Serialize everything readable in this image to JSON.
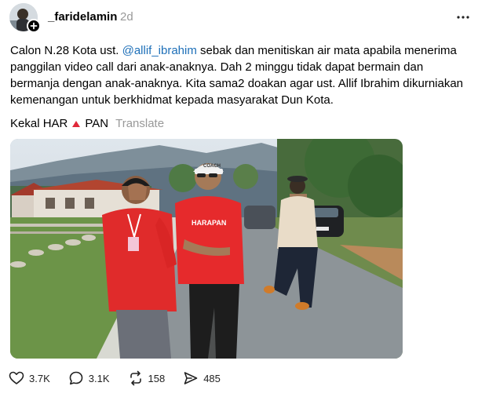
{
  "post": {
    "username": "_faridelamin",
    "timestamp": "2d",
    "caption": {
      "prefix": "Calon N.28 Kota ust. ",
      "mention": "@allif_ibrahim",
      "suffix": " sebak dan menitiskan air mata apabila menerima panggilan video call dari anak-anaknya. Dah 2 minggu tidak dapat bermain dan bermanja dengan anak-anaknya. Kita sama2 doakan agar ust. Allif Ibrahim dikurniakan kemenangan untuk berkhidmat kepada masyarakat Dun Kota."
    },
    "tags": {
      "left": "Kekal HAR",
      "right": "PAN",
      "translate_label": "Translate"
    },
    "photo": {
      "shirt_text": "HARAPAN",
      "cap_text": "COACH"
    },
    "actions": {
      "likes": "3.7K",
      "replies": "3.1K",
      "reposts": "158",
      "shares": "485"
    }
  },
  "icons": {
    "follow": "plus-icon",
    "more": "more-horizontal-icon",
    "like": "heart-icon",
    "reply": "comment-icon",
    "repost": "repost-icon",
    "share": "send-icon"
  },
  "colors": {
    "mention": "#1d6fb8",
    "timestamp": "#999999",
    "triangle": "#e0293a"
  }
}
